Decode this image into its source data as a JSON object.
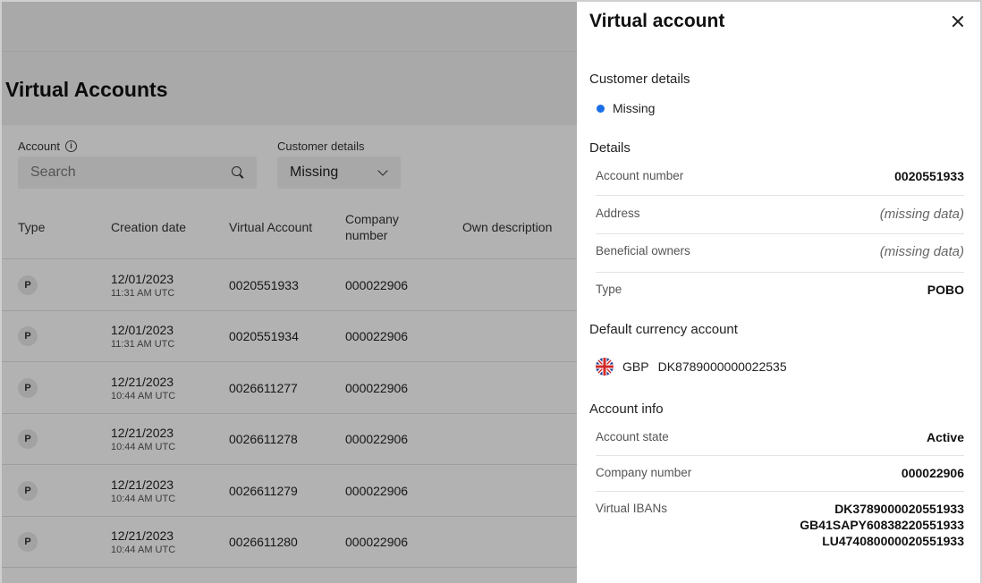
{
  "page": {
    "title": "Virtual Accounts",
    "filters": {
      "account_label": "Account",
      "search_placeholder": "Search",
      "customer_details_label": "Customer details",
      "customer_details_value": "Missing"
    },
    "table": {
      "columns": [
        "Type",
        "Creation date",
        "Virtual Account",
        "Company number",
        "Own description"
      ],
      "rows": [
        {
          "type": "P",
          "date": "12/01/2023",
          "time": "11:31 AM UTC",
          "virtual_account": "0020551933",
          "company_number": "000022906",
          "own_description": ""
        },
        {
          "type": "P",
          "date": "12/01/2023",
          "time": "11:31 AM UTC",
          "virtual_account": "0020551934",
          "company_number": "000022906",
          "own_description": ""
        },
        {
          "type": "P",
          "date": "12/21/2023",
          "time": "10:44 AM UTC",
          "virtual_account": "0026611277",
          "company_number": "000022906",
          "own_description": ""
        },
        {
          "type": "P",
          "date": "12/21/2023",
          "time": "10:44 AM UTC",
          "virtual_account": "0026611278",
          "company_number": "000022906",
          "own_description": ""
        },
        {
          "type": "P",
          "date": "12/21/2023",
          "time": "10:44 AM UTC",
          "virtual_account": "0026611279",
          "company_number": "000022906",
          "own_description": ""
        },
        {
          "type": "P",
          "date": "12/21/2023",
          "time": "10:44 AM UTC",
          "virtual_account": "0026611280",
          "company_number": "000022906",
          "own_description": ""
        }
      ]
    }
  },
  "drawer": {
    "title": "Virtual account",
    "customer_details": {
      "heading": "Customer details",
      "status": "Missing",
      "status_color": "#1a6fe8"
    },
    "details": {
      "heading": "Details",
      "account_number_label": "Account number",
      "account_number": "0020551933",
      "address_label": "Address",
      "address": "(missing data)",
      "beneficial_owners_label": "Beneficial owners",
      "beneficial_owners": "(missing data)",
      "type_label": "Type",
      "type": "POBO"
    },
    "default_currency": {
      "heading": "Default currency account",
      "currency": "GBP",
      "iban": "DK8789000000022535",
      "flag": "uk-flag-icon"
    },
    "account_info": {
      "heading": "Account info",
      "state_label": "Account state",
      "state": "Active",
      "company_number_label": "Company number",
      "company_number": "000022906",
      "virtual_ibans_label": "Virtual IBANs",
      "virtual_ibans": [
        "DK3789000020551933",
        "GB41SAPY60838220551933",
        "LU474080000020551933"
      ]
    }
  }
}
